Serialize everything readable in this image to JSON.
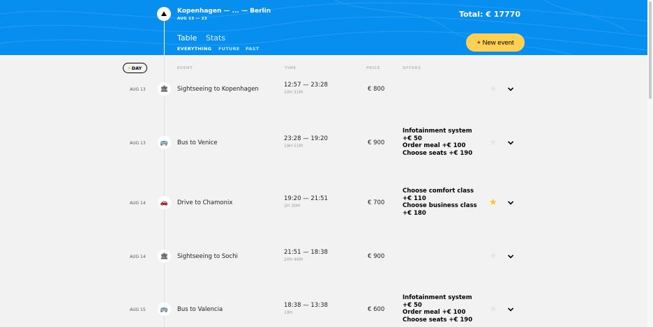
{
  "header": {
    "trip_title": "Kopenhagen — ... — Berlin",
    "trip_dates": "AUG 13 — 23",
    "total": "Total: € 17770",
    "logo_icon": "mountain-icon",
    "colors": {
      "header_bg": "#078ff0",
      "accent": "#ffd054"
    }
  },
  "tabs": {
    "table": "Table",
    "stats": "Stats"
  },
  "filters": {
    "everything": "EVERYTHING",
    "future": "FUTURE",
    "past": "PAST"
  },
  "new_event_label": "+ New event",
  "sort": {
    "day": "DAY",
    "event": "EVENT",
    "time": "TIME",
    "price": "PRICE",
    "offers": "OFFERS"
  },
  "events": [
    {
      "date": "AUG 13",
      "icon": "sightseeing-icon",
      "title": "Sightseeing to Kopenhagen",
      "time": "12:57 — 23:28",
      "duration": "10H 31M",
      "price": "€ 800",
      "offers": [],
      "favorite": false
    },
    {
      "date": "AUG 13",
      "icon": "bus-icon",
      "title": "Bus to Venice",
      "time": "23:28 — 19:20",
      "duration": "19H 51M",
      "price": "€ 900",
      "offers": [
        "Infotainment system +€ 50",
        "Order meal +€  100",
        "Choose seats +€  190"
      ],
      "favorite": false
    },
    {
      "date": "AUG 14",
      "icon": "car-icon",
      "title": "Drive to Chamonix",
      "time": "19:20 — 21:51",
      "duration": "2H 30M",
      "price": "€ 700",
      "offers": [
        "Choose comfort class +€  110",
        "Choose business class +€  180"
      ],
      "favorite": true
    },
    {
      "date": "AUG 14",
      "icon": "sightseeing-icon",
      "title": "Sightseeing to Sochi",
      "time": "21:51 — 18:38",
      "duration": "20H 46M",
      "price": "€ 900",
      "offers": [],
      "favorite": false
    },
    {
      "date": "AUG 15",
      "icon": "bus-icon",
      "title": "Bus to Valencia",
      "time": "18:38 — 13:38",
      "duration": "19H",
      "price": "€ 600",
      "offers": [
        "Infotainment system +€ 50",
        "Order meal +€  100",
        "Choose seats +€  190"
      ],
      "favorite": false
    }
  ]
}
